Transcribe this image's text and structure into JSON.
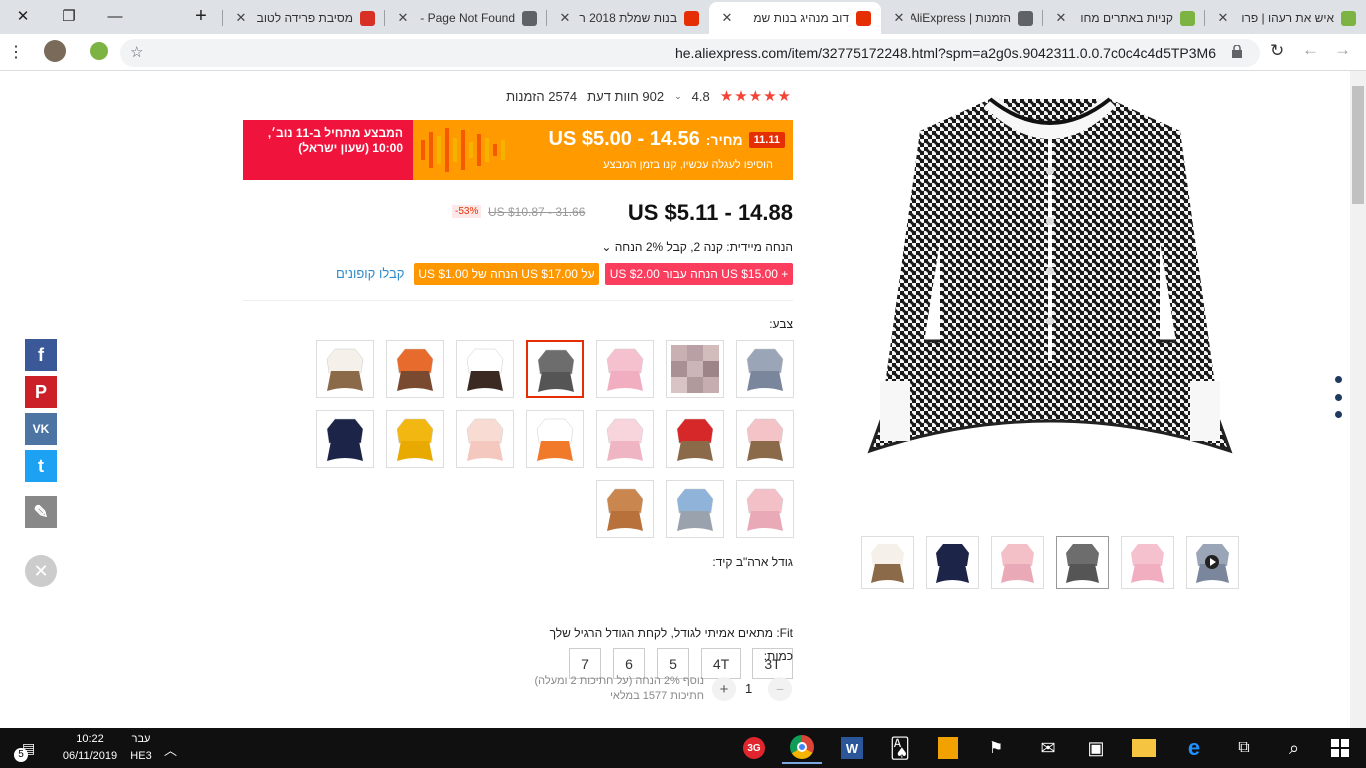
{
  "browser": {
    "tabs": [
      {
        "title": "איש את רעהו | פרו",
        "fav_color": "#7cb342"
      },
      {
        "title": "קניות באתרים מחו",
        "fav_color": "#7cb342"
      },
      {
        "title": "הזמנות | AliExpress",
        "fav_color": "#5f6368"
      },
      {
        "title": "דוב מנהיג בנות שמ",
        "fav_color": "#e62e04"
      },
      {
        "title": "בנות שמלת 2018 ר",
        "fav_color": "#e62e04"
      },
      {
        "title": "Page Not Found -",
        "fav_color": "#5f6368"
      },
      {
        "title": "מסיבת פרידה לטוב",
        "fav_color": "#d93025"
      }
    ],
    "active_tab_index": 3,
    "new_tab": "+",
    "url": "he.aliexpress.com/item/32775172248.html?spm=a2g0s.9042311.0.0.7c0c4c4d5TP3M6"
  },
  "product": {
    "rating_value": "4.8",
    "rating_stars": 5,
    "reviews": "902 חוות דעת",
    "orders": "2574 הזמנות",
    "promo": {
      "badge": "11.11",
      "price_label": "מחיר:",
      "price": "US $5.00 - 14.56",
      "sub": "הוסיפו לעגלה עכשיו, קנו בזמן המבצע",
      "starts": "המבצע מתחיל ב-11 נוב׳, 10:00 (שעון ישראל)"
    },
    "price": "US $5.11 - 14.88",
    "old_price": "US $10.87 - 31.66",
    "discount": "-53%",
    "instant_discount": "הנחה מיידית: קנה 2, קבל 2% הנחה ⌄",
    "coupon_1": "US $2.00 הנחה עבור US $15.00 +",
    "coupon_2": "US $1.00 הנחה של US $17.00 על",
    "get_coupons": "קבלו קופונים",
    "color_label": "צבע:",
    "size_label": "גודל ארה\"ב קיד:",
    "sizes": [
      "3T",
      "4T",
      "5",
      "6",
      "7"
    ],
    "fit": "Fit: מתאים אמיתי לגודל, לקחת הגודל הרגיל שלך",
    "qty_label": "כמות:",
    "qty": "1",
    "qty_minus": "−",
    "qty_plus": "+",
    "qty_note1": "נוסף 2% הנחה (על חתיכות 2 ומעלה)",
    "qty_note2": "חתיכות 1577 במלאי"
  },
  "colors": {
    "accent": "#e62e04",
    "promo_orange": "#ff9a00",
    "promo_red": "#f0143c",
    "coupon_red": "#fc3e5e",
    "coupon_orange": "#ff9800",
    "link_blue": "#2f8bc9"
  },
  "share": [
    {
      "name": "facebook",
      "glyph": "f",
      "color": "#3b5998"
    },
    {
      "name": "pinterest",
      "glyph": "P",
      "color": "#cb2027"
    },
    {
      "name": "vk",
      "glyph": "VK",
      "color": "#4c75a3"
    },
    {
      "name": "twitter",
      "glyph": "t",
      "color": "#1da1f2"
    },
    {
      "name": "edit",
      "glyph": "✎",
      "color": "#888888"
    }
  ],
  "taskbar": {
    "time": "10:22",
    "date": "06/11/2019",
    "lang": "עבר",
    "lang2": "HE3",
    "notif": "5"
  }
}
